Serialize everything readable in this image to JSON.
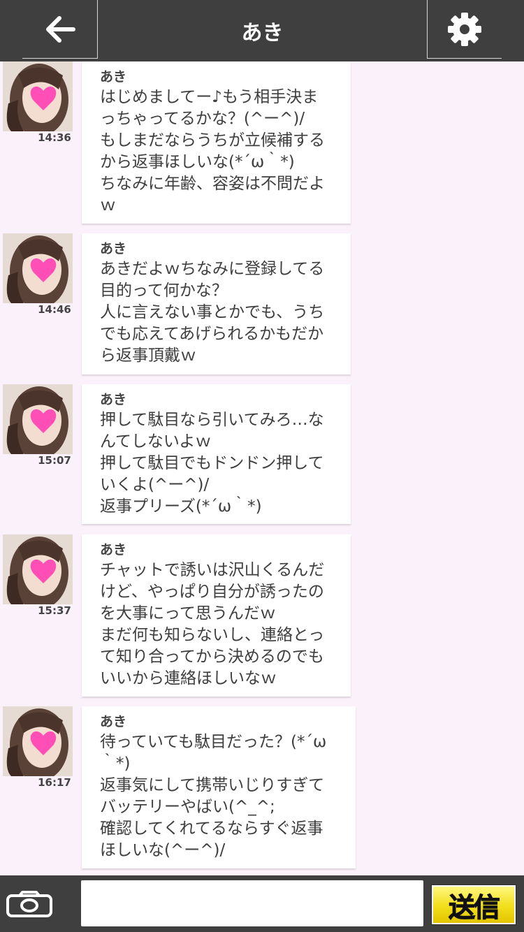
{
  "header": {
    "title": "あき",
    "back_icon": "arrow-left-icon",
    "settings_icon": "gear-icon"
  },
  "messages": [
    {
      "sender": "あき",
      "time": "14:36",
      "text": "はじめましてー♪もう相手決ま\nっちゃってるかな？(^ー^)/\nもしまだならうちが立候補する\nから返事ほしいな(*´ω｀*)\nちなみに年齢、容姿は不問だよ\nｗ"
    },
    {
      "sender": "あき",
      "time": "14:46",
      "text": "あきだよｗちなみに登録してる\n目的って何かな？\n人に言えない事とかでも、うち\nでも応えてあげられるかもだか\nら返事頂戴ｗ"
    },
    {
      "sender": "あき",
      "time": "15:07",
      "text": "押して駄目なら引いてみろ…な\nんてしないよｗ\n押して駄目でもドンドン押して\nいくよ(^ー^)/\n返事プリーズ(*´ω｀*)"
    },
    {
      "sender": "あき",
      "time": "15:37",
      "text": "チャットで誘いは沢山くるんだ\nけど、やっぱり自分が誘ったの\nを大事にって思うんだｗ\nまだ何も知らないし、連絡とっ\nて知り合ってから決めるのでも\nいいから連絡ほしいなｗ"
    },
    {
      "sender": "あき",
      "time": "16:17",
      "text": "待っていても駄目だった？(*´ω\n｀*)\n返事気にして携帯いじりすぎて\nバッテリーやばい(^_^;\n確認してくれてるならすぐ返事\nほしいな(^ー^)/"
    }
  ],
  "footer": {
    "camera_icon": "camera-icon",
    "input_value": "",
    "input_placeholder": "",
    "send_label": "送信"
  },
  "colors": {
    "header_bg": "#3f3f3f",
    "chat_bg": "#fbf1fb",
    "bubble_bg": "#ffffff",
    "heart": "#ff4fb6",
    "send_button": "#f2de1a"
  }
}
